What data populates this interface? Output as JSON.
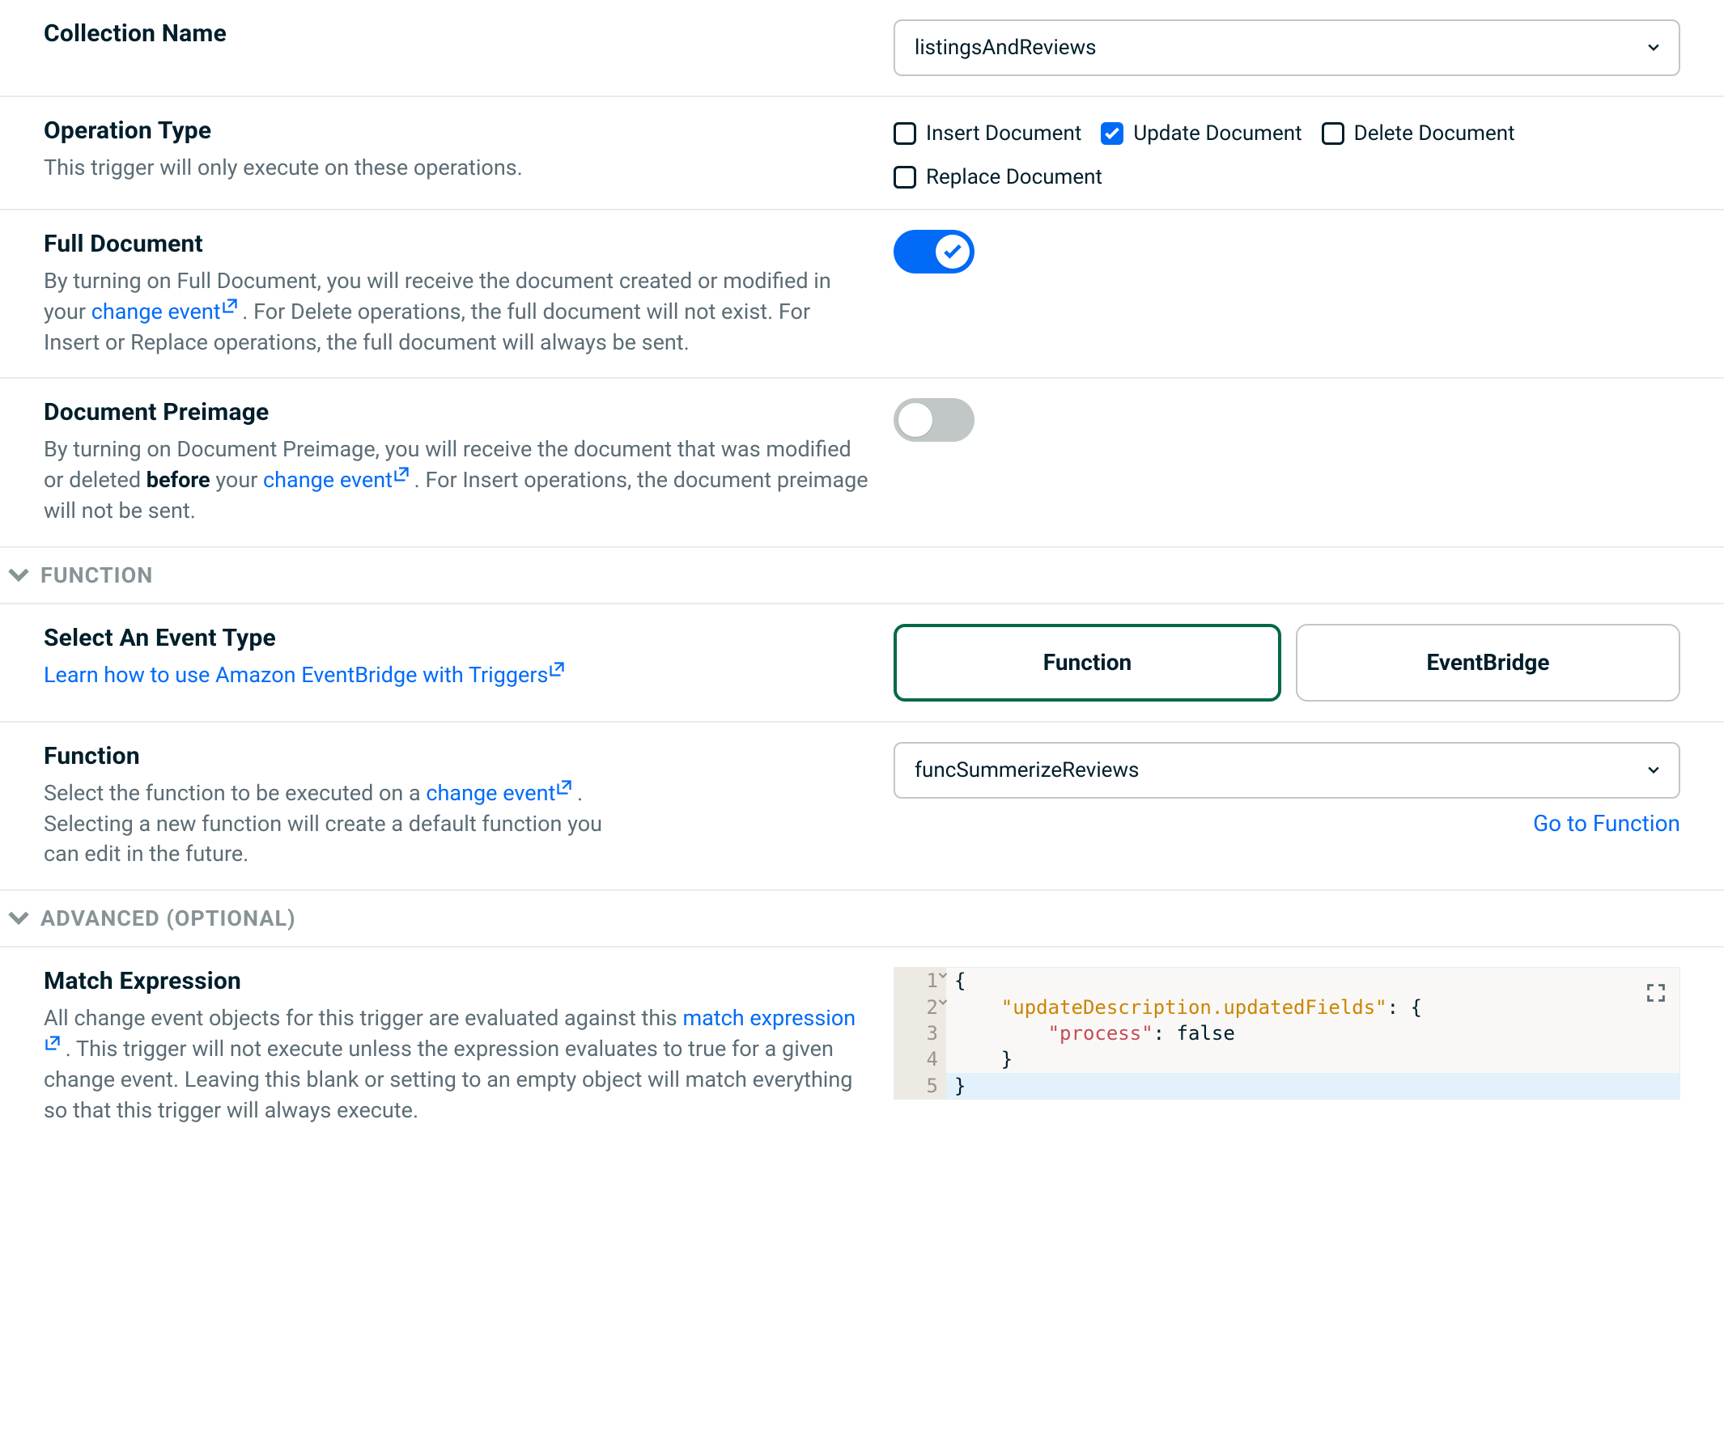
{
  "collectionName": {
    "title": "Collection Name",
    "value": "listingsAndReviews"
  },
  "operationType": {
    "title": "Operation Type",
    "help": "This trigger will only execute on these operations.",
    "options": {
      "insert": {
        "label": "Insert Document",
        "checked": false
      },
      "update": {
        "label": "Update Document",
        "checked": true
      },
      "delete": {
        "label": "Delete Document",
        "checked": false
      },
      "replace": {
        "label": "Replace Document",
        "checked": false
      }
    }
  },
  "fullDocument": {
    "title": "Full Document",
    "help_before_link": "By turning on Full Document, you will receive the document created or modified in your ",
    "link_text": "change event",
    "help_after_link": " . For Delete operations, the full document will not exist. For Insert or Replace operations, the full document will always be sent.",
    "on": true
  },
  "documentPreimage": {
    "title": "Document Preimage",
    "help_before_link": "By turning on Document Preimage, you will receive the document that was modified or deleted ",
    "bold_word": "before",
    "help_mid": " your ",
    "link_text": "change event",
    "help_after_link": " . For Insert operations, the document preimage will not be sent.",
    "on": false
  },
  "sectionFunction": {
    "label": "FUNCTION"
  },
  "eventType": {
    "title": "Select An Event Type",
    "learn_link": "Learn how to use Amazon EventBridge with Triggers",
    "options": {
      "function": "Function",
      "eventbridge": "EventBridge"
    },
    "selected": "function"
  },
  "functionField": {
    "title": "Function",
    "help_before_link": "Select the function to be executed on a ",
    "link_text": "change event",
    "help_after_link": " . Selecting a new function will create a default function you can edit in the future.",
    "value": "funcSummerizeReviews",
    "go_link": "Go to Function"
  },
  "sectionAdvanced": {
    "label": "ADVANCED (OPTIONAL)"
  },
  "matchExpression": {
    "title": "Match Expression",
    "help_before_link": "All change event objects for this trigger are evaluated against this ",
    "link_text": "match expression",
    "help_after_link": " . This trigger will not execute unless the expression evaluates to true for a given change event. Leaving this blank or setting to an empty object will match everything so that this trigger will always execute.",
    "code": {
      "lines": [
        {
          "n": "1",
          "text": "{",
          "fold": true
        },
        {
          "n": "2",
          "text": "    \"updateDescription.updatedFields\": {",
          "fold": true,
          "seg": [
            " ",
            "    ",
            "\"updateDescription.updatedFields\"",
            ": {"
          ]
        },
        {
          "n": "3",
          "text": "        \"process\": false",
          "seg": [
            "",
            "        ",
            "\"process\"",
            ": ",
            "false"
          ]
        },
        {
          "n": "4",
          "text": "    }"
        },
        {
          "n": "5",
          "text": "}",
          "sel": true
        }
      ]
    }
  }
}
